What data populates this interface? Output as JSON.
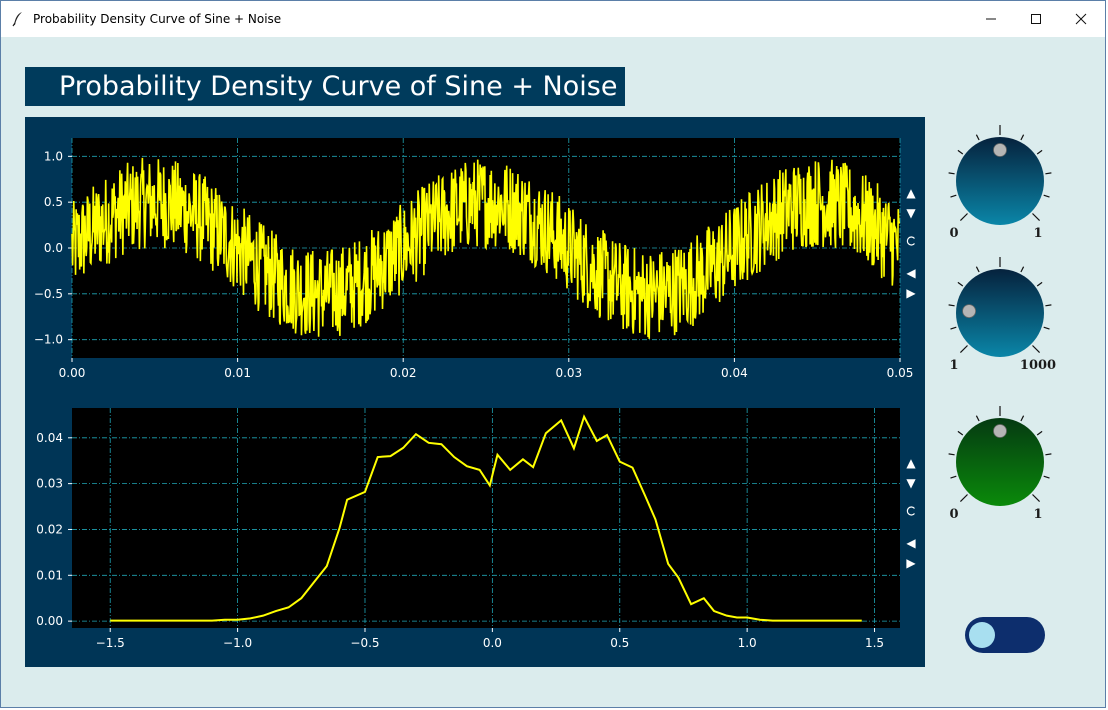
{
  "window": {
    "title": "Probability Density Curve of Sine + Noise",
    "minimize_glyph": "—",
    "maximize_glyph": "☐",
    "close_glyph": "✕"
  },
  "header": {
    "title": "Probability Density Curve of Sine + Noise"
  },
  "toolbar": {
    "up": "▲",
    "down": "▼",
    "reset": "C",
    "left": "◀",
    "right": "▶"
  },
  "knobs": [
    {
      "name": "amplitude-knob",
      "min_label": "0",
      "max_label": "1",
      "value": 0.5,
      "color_top": "#06223d",
      "color_bottom": "#0a86a8"
    },
    {
      "name": "noise-knob",
      "min_label": "1",
      "max_label": "1000",
      "value": 0.18,
      "color_top": "#06223d",
      "color_bottom": "#0a86a8"
    },
    {
      "name": "level-knob",
      "min_label": "0",
      "max_label": "1",
      "value": 0.5,
      "color_top": "#053a12",
      "color_bottom": "#0a8a0a"
    }
  ],
  "toggle": {
    "state": "off"
  },
  "chart_data": [
    {
      "type": "line",
      "title": "",
      "xlabel": "",
      "ylabel": "",
      "xlim": [
        0,
        0.05
      ],
      "ylim": [
        -1.2,
        1.2
      ],
      "xticks": [
        "0.00",
        "0.01",
        "0.02",
        "0.03",
        "0.04",
        "0.05"
      ],
      "yticks": [
        "1.0",
        "0.5",
        "0.0",
        "−0.5",
        "−1.0"
      ],
      "grid": true,
      "background": "#000000",
      "line_color": "#ffff00",
      "signal": {
        "function": "sine",
        "amplitude": 0.5,
        "period": 0.02,
        "noise_range": [
          -0.5,
          0.5
        ]
      }
    },
    {
      "type": "line",
      "title": "",
      "xlabel": "",
      "ylabel": "",
      "xlim": [
        -1.65,
        1.6
      ],
      "ylim": [
        -0.0015,
        0.0465
      ],
      "xticks": [
        "−1.5",
        "−1.0",
        "−0.5",
        "0.0",
        "0.5",
        "1.0",
        "1.5"
      ],
      "yticks": [
        "0.04",
        "0.03",
        "0.02",
        "0.01",
        "0.00"
      ],
      "grid": true,
      "background": "#000000",
      "line_color": "#ffff00",
      "x": [
        -1.5,
        -1.45,
        -1.4,
        -1.35,
        -1.3,
        -1.25,
        -1.2,
        -1.15,
        -1.1,
        -1.05,
        -1.0,
        -0.95,
        -0.9,
        -0.85,
        -0.8,
        -0.75,
        -0.7,
        -0.65,
        -0.6,
        -0.57,
        -0.5,
        -0.45,
        -0.4,
        -0.35,
        -0.3,
        -0.25,
        -0.2,
        -0.15,
        -0.1,
        -0.05,
        -0.01,
        0.02,
        0.07,
        0.12,
        0.16,
        0.21,
        0.27,
        0.32,
        0.36,
        0.41,
        0.45,
        0.5,
        0.55,
        0.6,
        0.64,
        0.69,
        0.73,
        0.78,
        0.83,
        0.87,
        0.92,
        0.96,
        1.0,
        1.05,
        1.1,
        1.2,
        1.3,
        1.4,
        1.45
      ],
      "values": [
        0.0001,
        0.0001,
        0.0001,
        0.0001,
        0.0001,
        0.0001,
        0.0001,
        0.0001,
        0.0001,
        0.0003,
        0.0003,
        0.0006,
        0.0012,
        0.0022,
        0.003,
        0.005,
        0.0085,
        0.012,
        0.0203,
        0.0265,
        0.0282,
        0.0358,
        0.036,
        0.0378,
        0.0408,
        0.0389,
        0.0386,
        0.0358,
        0.0338,
        0.033,
        0.0296,
        0.0363,
        0.033,
        0.0353,
        0.0336,
        0.041,
        0.0438,
        0.0377,
        0.0446,
        0.0393,
        0.0406,
        0.0348,
        0.0335,
        0.0273,
        0.0222,
        0.0125,
        0.0095,
        0.0037,
        0.005,
        0.0022,
        0.0012,
        0.0008,
        0.0008,
        0.0003,
        0.0001,
        0.0001,
        0.0001,
        0.0001,
        0.0001
      ]
    }
  ]
}
